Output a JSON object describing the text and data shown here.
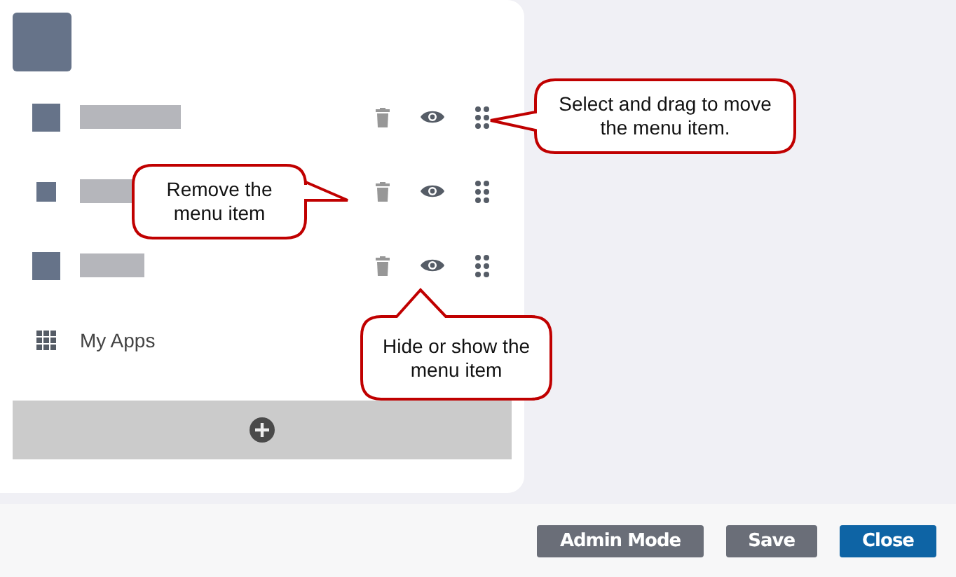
{
  "menu_items": [
    {
      "kind": "blank"
    },
    {
      "kind": "blank"
    },
    {
      "kind": "blank"
    },
    {
      "kind": "apps",
      "label": "My Apps"
    }
  ],
  "callouts": [
    {
      "text": "Select and drag to move the menu item."
    },
    {
      "text": "Remove the menu item"
    },
    {
      "text": "Hide or show the menu item"
    }
  ],
  "buttons": [
    {
      "label": "Admin Mode",
      "kind": "secondary"
    },
    {
      "label": "Save",
      "kind": "secondary"
    },
    {
      "label": "Close",
      "kind": "primary"
    }
  ]
}
